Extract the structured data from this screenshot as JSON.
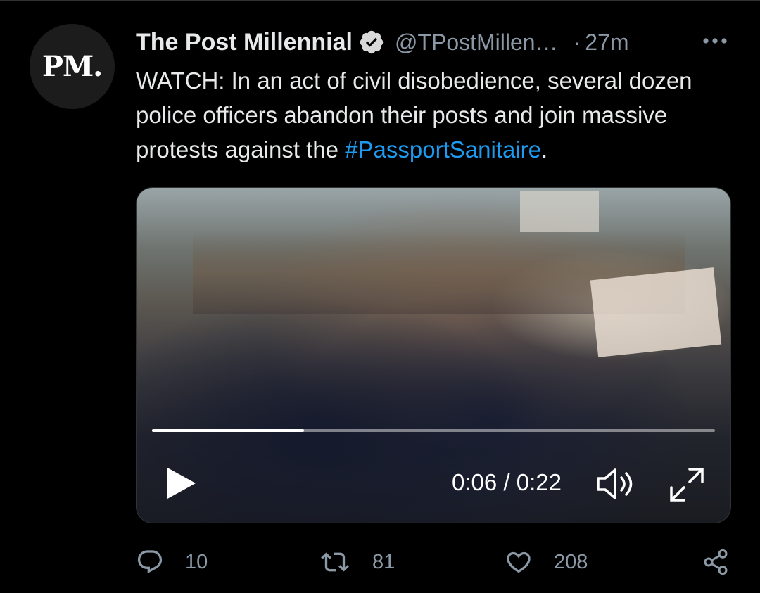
{
  "tweet": {
    "avatar_text": "PM.",
    "display_name": "The Post Millennial",
    "handle": "@TPostMillen…",
    "separator": "·",
    "time": "27m",
    "text_before": "WATCH: In an act of civil disobedience, several dozen police officers abandon their posts and join massive protests against the ",
    "hashtag": "#PassportSanitaire",
    "text_after": "."
  },
  "video": {
    "timecode": "0:06 / 0:22",
    "progress": 0.27
  },
  "actions": {
    "replies": "10",
    "retweets": "81",
    "likes": "208"
  },
  "colors": {
    "background": "#000000",
    "text": "#e7e9ea",
    "secondary": "#8b98a5",
    "link": "#1d9bf0",
    "border": "#2f3336"
  },
  "icons": [
    "verified-icon",
    "more-icon",
    "play-icon",
    "volume-icon",
    "fullscreen-icon",
    "reply-icon",
    "retweet-icon",
    "like-icon",
    "share-icon"
  ]
}
